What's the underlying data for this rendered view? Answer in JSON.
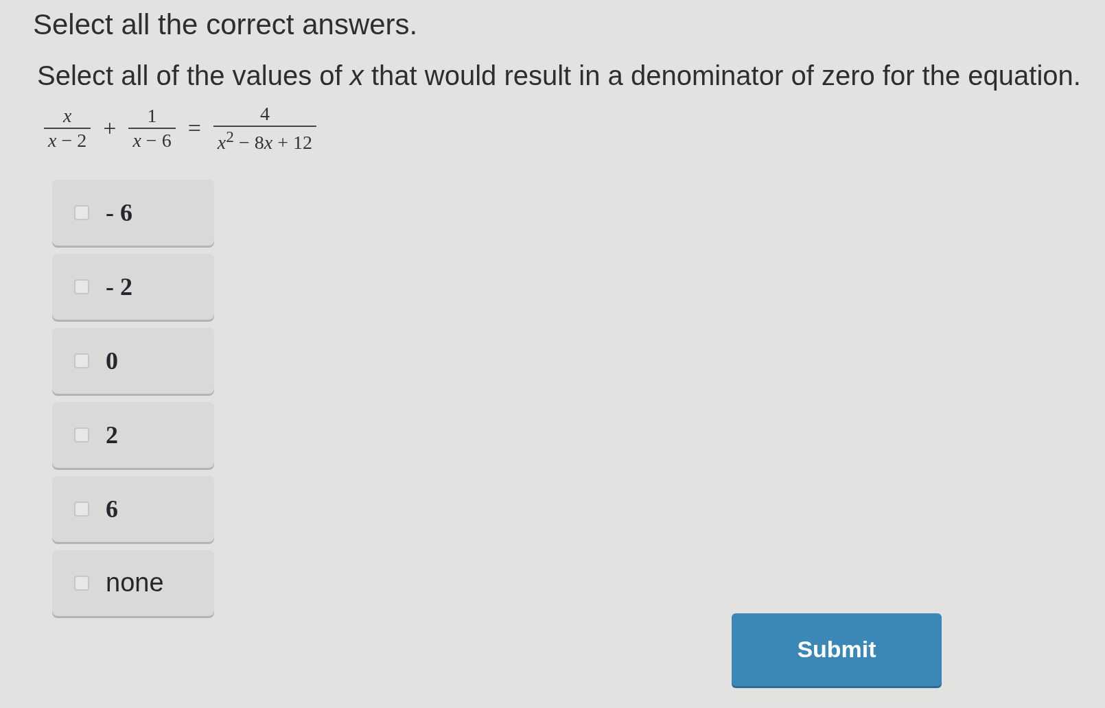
{
  "instruction": "Select all the correct answers.",
  "question": "Select all of the values of *x* that would result in a denominator of zero for the equation.",
  "equation": [
    {
      "kind": "fraction",
      "numerator": "x",
      "denominator": "x − 2"
    },
    {
      "kind": "operator",
      "text": "+"
    },
    {
      "kind": "fraction",
      "numerator": "1",
      "denominator": "x − 6"
    },
    {
      "kind": "operator",
      "text": "="
    },
    {
      "kind": "fraction",
      "numerator": "4",
      "denominator": "x$^{2}$ − 8x + 12"
    }
  ],
  "options": [
    {
      "kind": "math",
      "label": "- 6",
      "checked": false
    },
    {
      "kind": "math",
      "label": "- 2",
      "checked": false
    },
    {
      "kind": "math",
      "label": "0",
      "checked": false
    },
    {
      "kind": "math",
      "label": "2",
      "checked": false
    },
    {
      "kind": "math",
      "label": "6",
      "checked": false
    },
    {
      "kind": "text",
      "label": "none",
      "checked": false
    }
  ],
  "submit_button": {
    "label": "Submit"
  }
}
